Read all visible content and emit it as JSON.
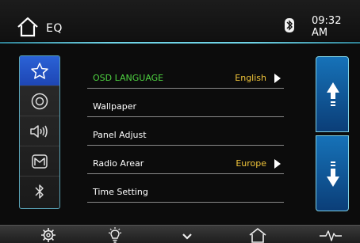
{
  "header": {
    "title": "EQ",
    "time": "09:32 AM",
    "home_icon": "home-icon",
    "status_icon": "bluetooth-icon"
  },
  "tabs": [
    {
      "name": "favorites",
      "icon": "star-icon",
      "active": true
    },
    {
      "name": "disc",
      "icon": "disc-icon",
      "active": false
    },
    {
      "name": "audio",
      "icon": "speaker-icon",
      "active": false
    },
    {
      "name": "map",
      "icon": "map-icon",
      "active": false
    },
    {
      "name": "bluetooth",
      "icon": "bluetooth-icon",
      "active": false
    }
  ],
  "settings": {
    "rows": [
      {
        "label": "OSD LANGUAGE",
        "value": "English",
        "highlight": true
      },
      {
        "label": "Wallpaper",
        "value": ""
      },
      {
        "label": "Panel Adjust",
        "value": ""
      },
      {
        "label": "Radio Arear",
        "value": "Europe"
      },
      {
        "label": "Time Setting",
        "value": ""
      }
    ]
  },
  "scroll": {
    "up_icon": "arrow-up-icon",
    "down_icon": "arrow-down-icon"
  },
  "bottom_bar": {
    "icons": [
      "settings-gear-icon",
      "light-bulb-icon",
      "chevron-down-icon",
      "home-icon",
      "waveform-icon"
    ]
  },
  "colors": {
    "accent": "#6fd3e6",
    "active_tab": "#2a62d6",
    "highlight_text": "#4ed140",
    "value_text": "#f1c53a",
    "scroll_button": "#1672b8"
  }
}
